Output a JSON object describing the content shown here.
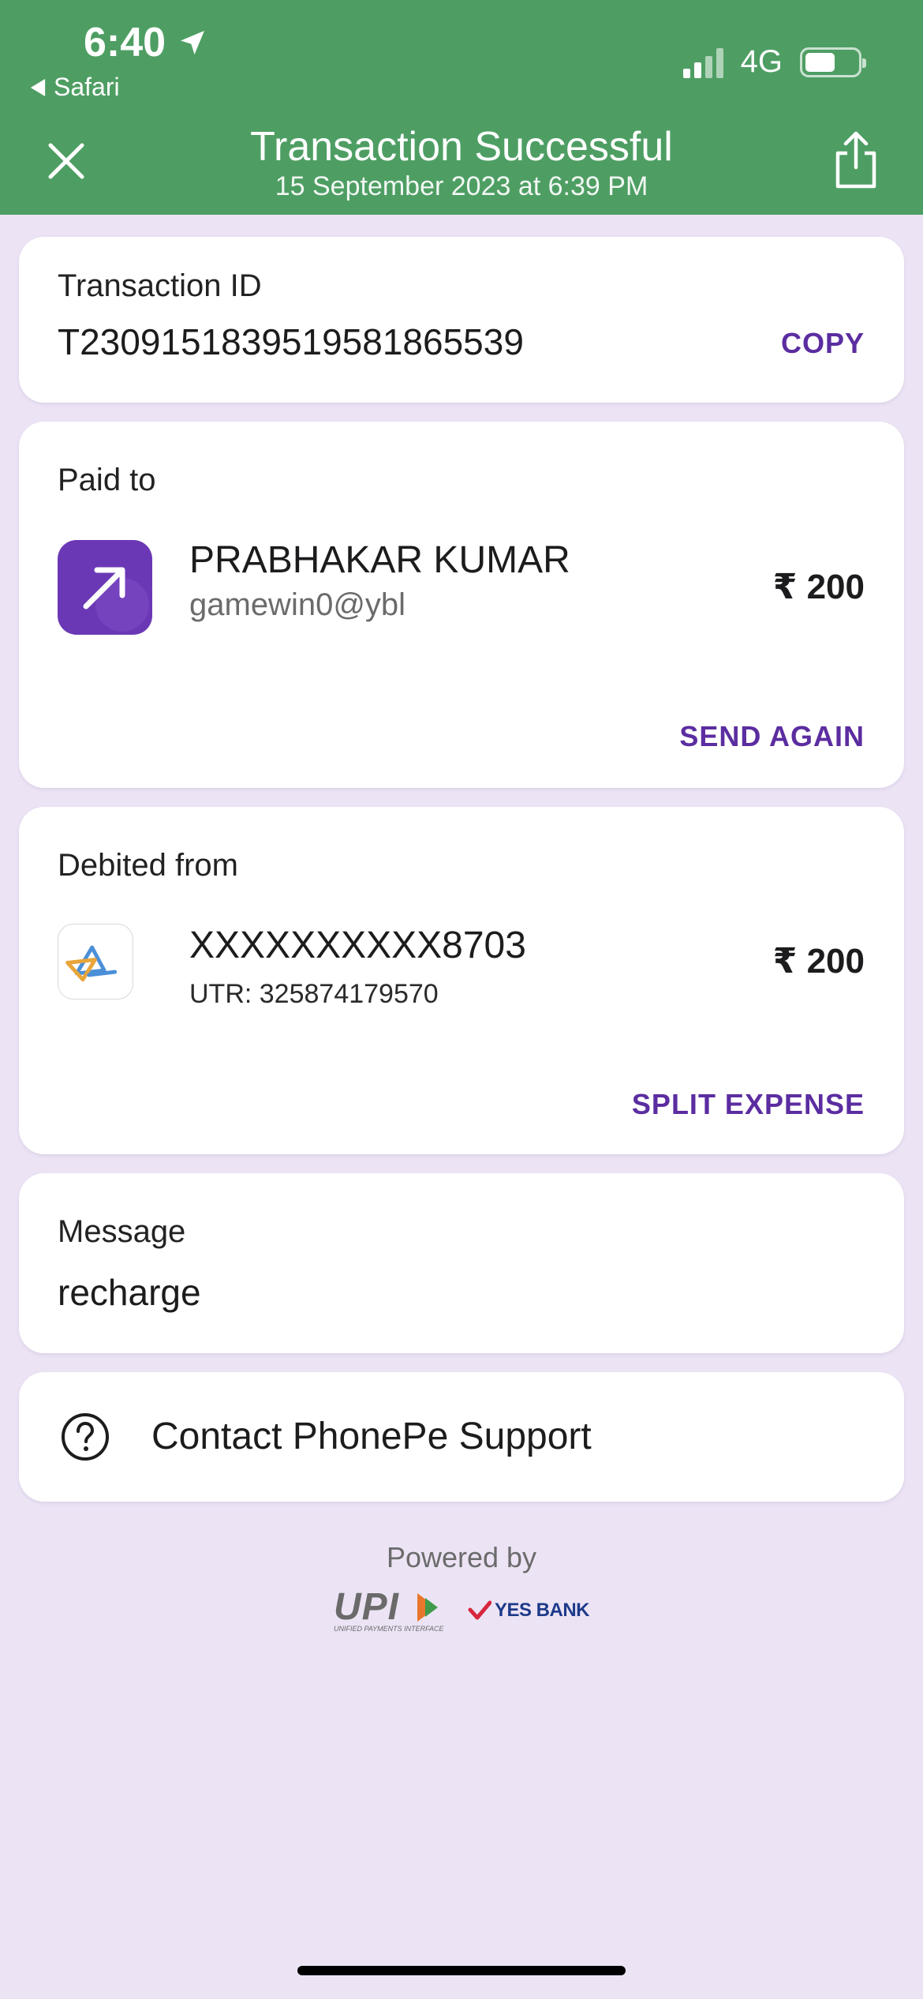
{
  "status_bar": {
    "time": "6:40",
    "back_app": "Safari",
    "network": "4G",
    "battery_level": 0.58
  },
  "header": {
    "title": "Transaction Successful",
    "subtitle": "15 September 2023 at 6:39 PM",
    "close_icon": "close-icon",
    "share_icon": "share-icon"
  },
  "transaction": {
    "label": "Transaction ID",
    "id": "T2309151839519581865539",
    "copy_label": "COPY"
  },
  "paid_to": {
    "label": "Paid to",
    "name": "PRABHAKAR KUMAR",
    "upi_id": "gamewin0@ybl",
    "amount": "₹ 200",
    "action_label": "SEND AGAIN"
  },
  "debited_from": {
    "label": "Debited from",
    "account": "XXXXXXXXXX8703",
    "utr": "UTR: 325874179570",
    "amount": "₹ 200",
    "action_label": "SPLIT EXPENSE"
  },
  "message": {
    "label": "Message",
    "text": "recharge"
  },
  "support": {
    "label": "Contact PhonePe Support",
    "icon": "help-circle-icon"
  },
  "footer": {
    "powered_by": "Powered by",
    "upi_logo_text": "UPI",
    "upi_logo_sub": "UNIFIED PAYMENTS INTERFACE",
    "bank_logo_text": "YES BANK"
  },
  "colors": {
    "header_green": "#4E9E63",
    "background": "#ECE4F5",
    "accent_purple": "#5B2DA0"
  }
}
